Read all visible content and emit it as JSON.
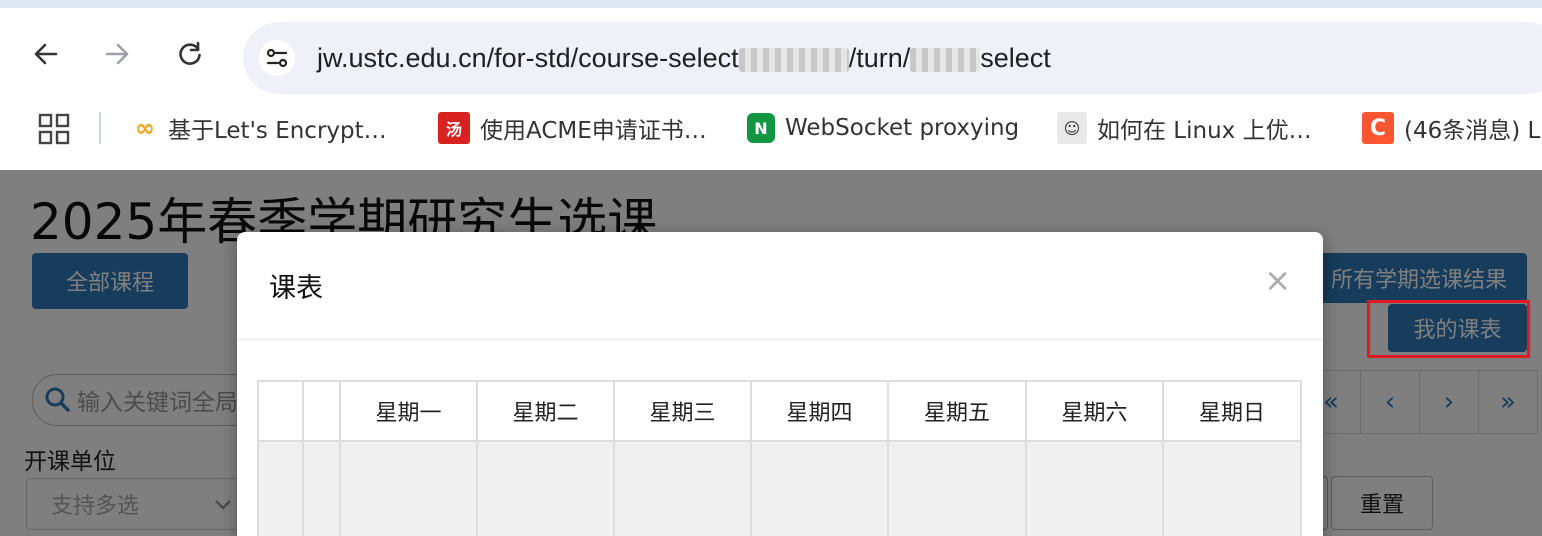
{
  "browser": {
    "url_prefix": "jw.ustc.edu.cn/for-std/course-select",
    "url_middle": "/turn/",
    "url_suffix": "select"
  },
  "bookmarks": [
    {
      "label": "基于Let's Encrypt…",
      "icon": "infinity-favicon",
      "color": "#f7a21b"
    },
    {
      "label": "使用ACME申请证书…",
      "icon": "red-seal-favicon",
      "color": "#d8221f"
    },
    {
      "label": "WebSocket proxying",
      "icon": "nginx-favicon",
      "color": "#119742"
    },
    {
      "label": "如何在 Linux 上优…",
      "icon": "avatar-favicon",
      "color": "#777777"
    },
    {
      "label": "(46条消息) L",
      "icon": "csdn-favicon",
      "color": "#fc5531"
    }
  ],
  "page": {
    "title": "2025年春季学期研究生选课",
    "all_courses_button": "全部课程",
    "results_button": "所有学期选课结果",
    "my_schedule_button": "我的课表",
    "search_placeholder": "输入关键词全局",
    "unit_label": "开课单位",
    "unit_placeholder": "支持多选",
    "reset_button": "重置",
    "pager": [
      "«",
      "‹",
      "›",
      "»"
    ]
  },
  "modal": {
    "title": "课表",
    "close": "×",
    "weekdays": [
      "星期一",
      "星期二",
      "星期三",
      "星期四",
      "星期五",
      "星期六",
      "星期日"
    ]
  },
  "colors": {
    "primary": "#2f78b9",
    "highlight": "#e01b24"
  }
}
